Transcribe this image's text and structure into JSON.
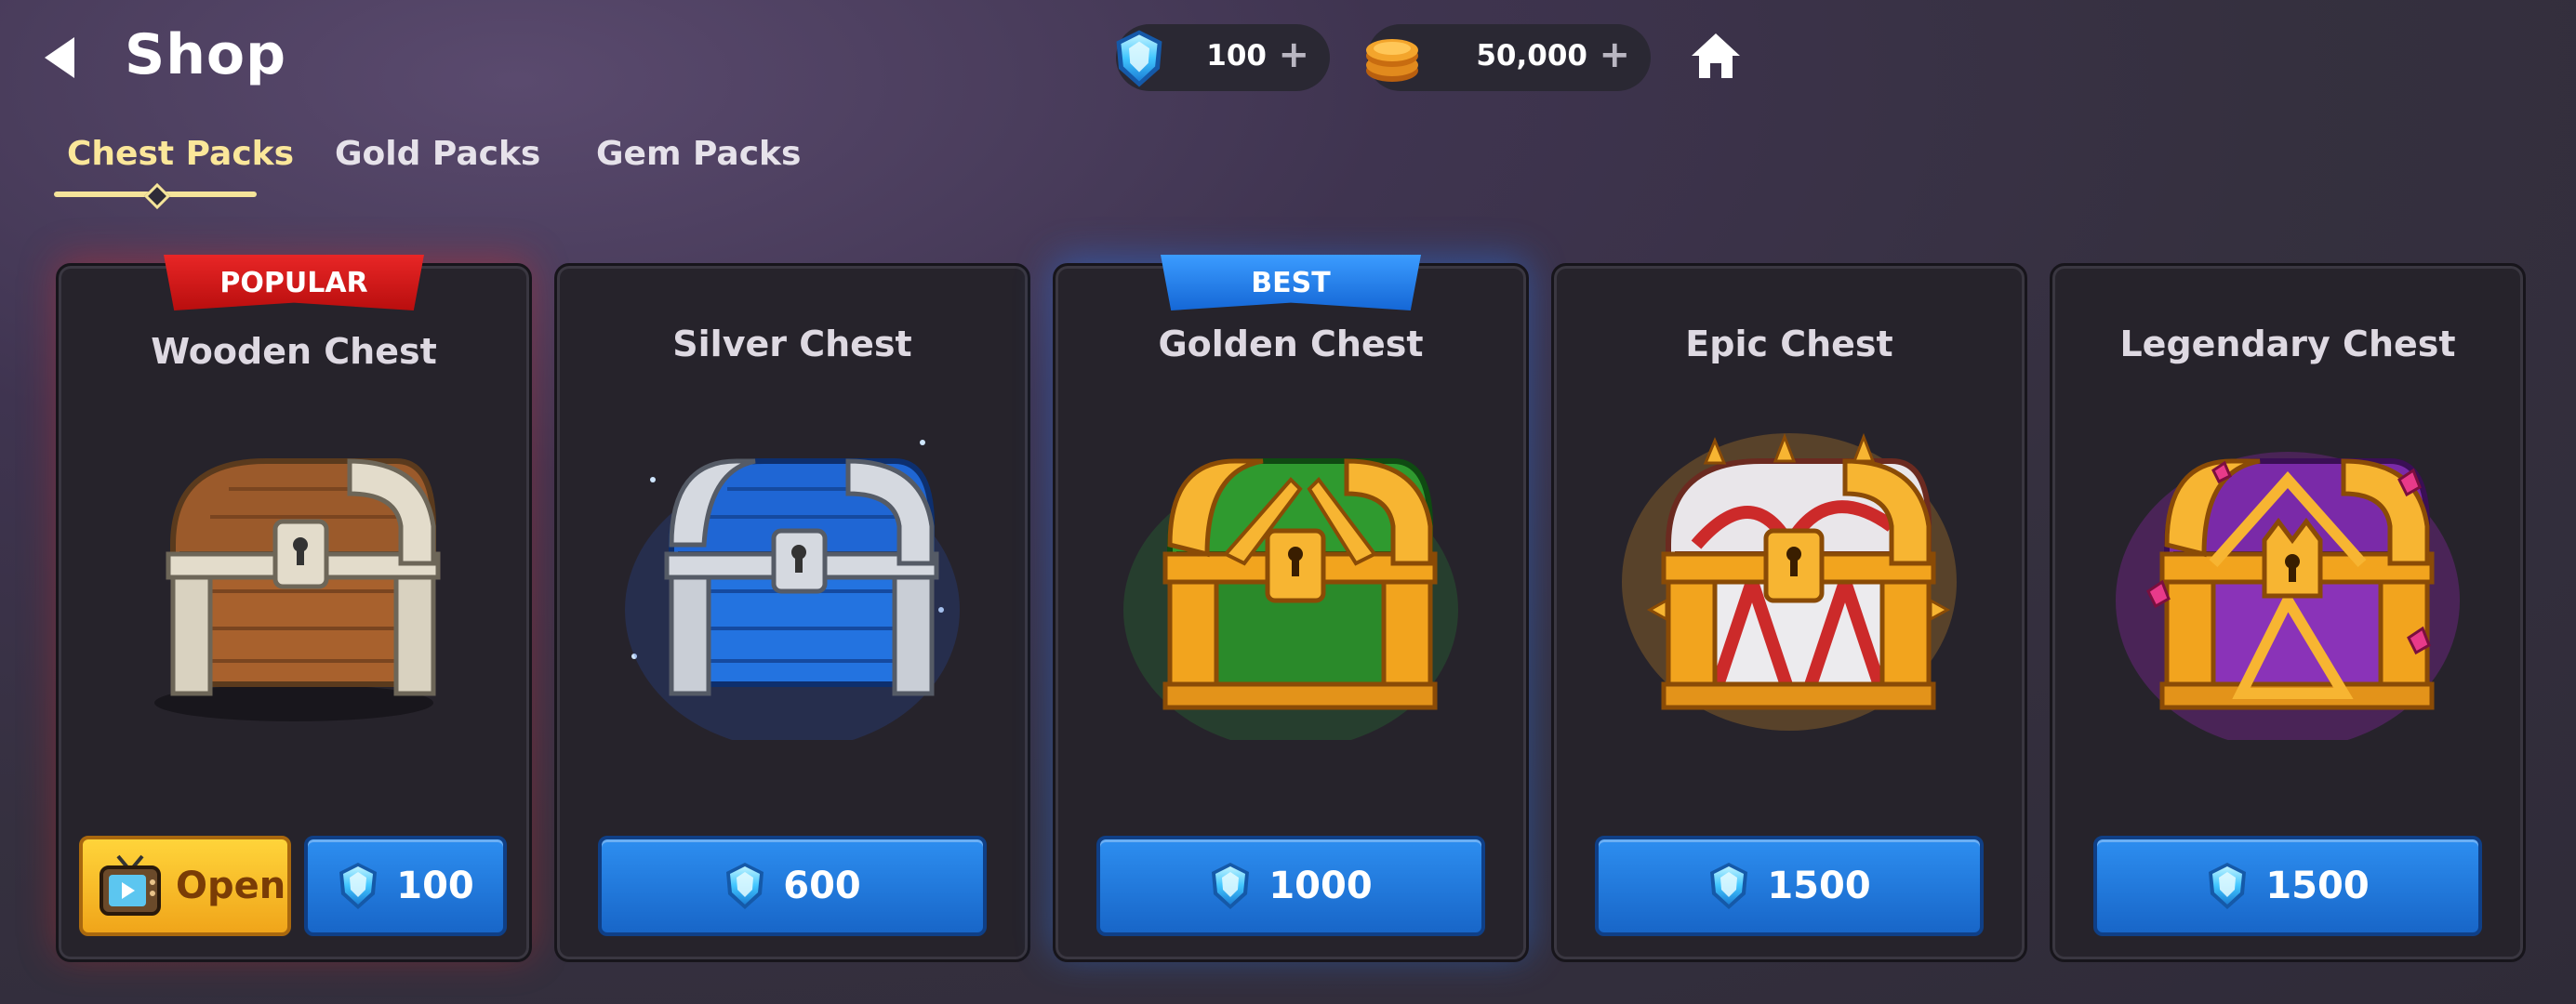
{
  "header": {
    "title": "Shop",
    "gems": {
      "amount": "100",
      "plus": "+"
    },
    "gold": {
      "amount": "50,000",
      "plus": "+"
    }
  },
  "tabs": [
    {
      "label": "Chest Packs",
      "active": true
    },
    {
      "label": "Gold Packs",
      "active": false
    },
    {
      "label": "Gem Packs",
      "active": false
    }
  ],
  "cards": [
    {
      "name": "Wooden Chest",
      "ribbon": "POPULAR",
      "open_label": "Open",
      "price": "100",
      "chest_icon": "wooden-chest"
    },
    {
      "name": "Silver Chest",
      "ribbon": "",
      "price": "600",
      "chest_icon": "silver-chest"
    },
    {
      "name": "Golden Chest",
      "ribbon": "BEST",
      "price": "1000",
      "chest_icon": "golden-chest"
    },
    {
      "name": "Epic Chest",
      "ribbon": "",
      "price": "1500",
      "chest_icon": "epic-chest"
    },
    {
      "name": "Legendary Chest",
      "ribbon": "",
      "price": "1500",
      "chest_icon": "legendary-chest"
    }
  ],
  "colors": {
    "accent": "#fbe79a",
    "button_blue": "#2d8ef0",
    "popular_red": "#e82626",
    "best_blue": "#3b9cff"
  }
}
